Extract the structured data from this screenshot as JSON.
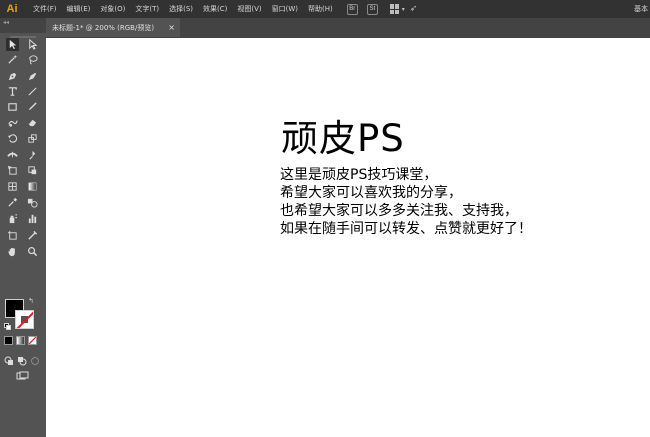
{
  "app": {
    "logo": "Ai",
    "menu": [
      "文件(F)",
      "编辑(E)",
      "对象(O)",
      "文字(T)",
      "选择(S)",
      "效果(C)",
      "视图(V)",
      "窗口(W)",
      "帮助(H)"
    ],
    "bridge_badge": "Br",
    "stock_badge": "St",
    "right_cut_text": "基本"
  },
  "document": {
    "tab_title": "未标题-1* @ 200% (RGB/预览)",
    "close_glyph": "×"
  },
  "toolbar": {
    "tools": [
      "selection",
      "direct-selection",
      "magic-wand",
      "lasso",
      "pen",
      "curvature",
      "type",
      "line-segment",
      "rectangle",
      "paintbrush",
      "shaper",
      "eraser",
      "rotate",
      "scale",
      "width",
      "puppet-warp",
      "free-transform",
      "shape-builder",
      "perspective-grid",
      "gradient",
      "eyedropper",
      "blend",
      "symbol-sprayer",
      "column-graph",
      "artboard",
      "slice",
      "hand",
      "zoom"
    ],
    "active_tool": "selection",
    "fill_color": "#000000",
    "stroke_color": "#ffffff",
    "stroke_none_indicator": "#e21c1c"
  },
  "canvas": {
    "title": "顽皮PS",
    "body_lines": [
      "这里是顽皮PS技巧课堂，",
      "希望大家可以喜欢我的分享，",
      "也希望大家可以多多关注我、支持我，",
      "如果在随手间可以转发、点赞就更好了！"
    ]
  },
  "colors": {
    "menubar_bg": "#323232",
    "ui_bg": "#535353",
    "logo": "#ff9a00",
    "canvas_bg": "#ffffff"
  }
}
